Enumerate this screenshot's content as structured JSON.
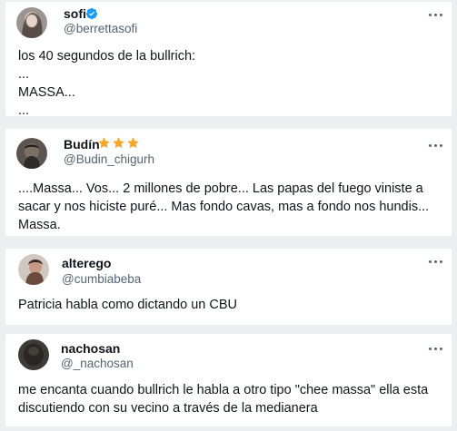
{
  "tweets": [
    {
      "name": "sofi",
      "handle": "@berrettasofi",
      "lines": [
        "los 40 segundos de la bullrich:",
        "...",
        "MASSA...",
        "..."
      ],
      "badge": "verified-icon",
      "accent": "#1d9bf0"
    },
    {
      "name": "Budín",
      "handle": "@Budin_chigurh",
      "lines": [
        "....Massa... Vos... 2 millones de pobre... Las papas del fuego viniste a",
        "sacar y nos hiciste puré... Mas fondo cavas, mas a fondo nos hundis...",
        "Massa."
      ],
      "badge": "star-icon",
      "accent": "#f5a623"
    },
    {
      "name": "alterego",
      "handle": "@cumbiabeba",
      "lines": [
        "Patricia habla como dictando un CBU"
      ]
    },
    {
      "name": "nachosan",
      "handle": "@_nachosan",
      "lines": [
        "me encanta cuando bullrich le habla a otro tipo \"chee massa\" ella esta",
        "discutiendo con su vecino a través de la medianera"
      ]
    }
  ]
}
